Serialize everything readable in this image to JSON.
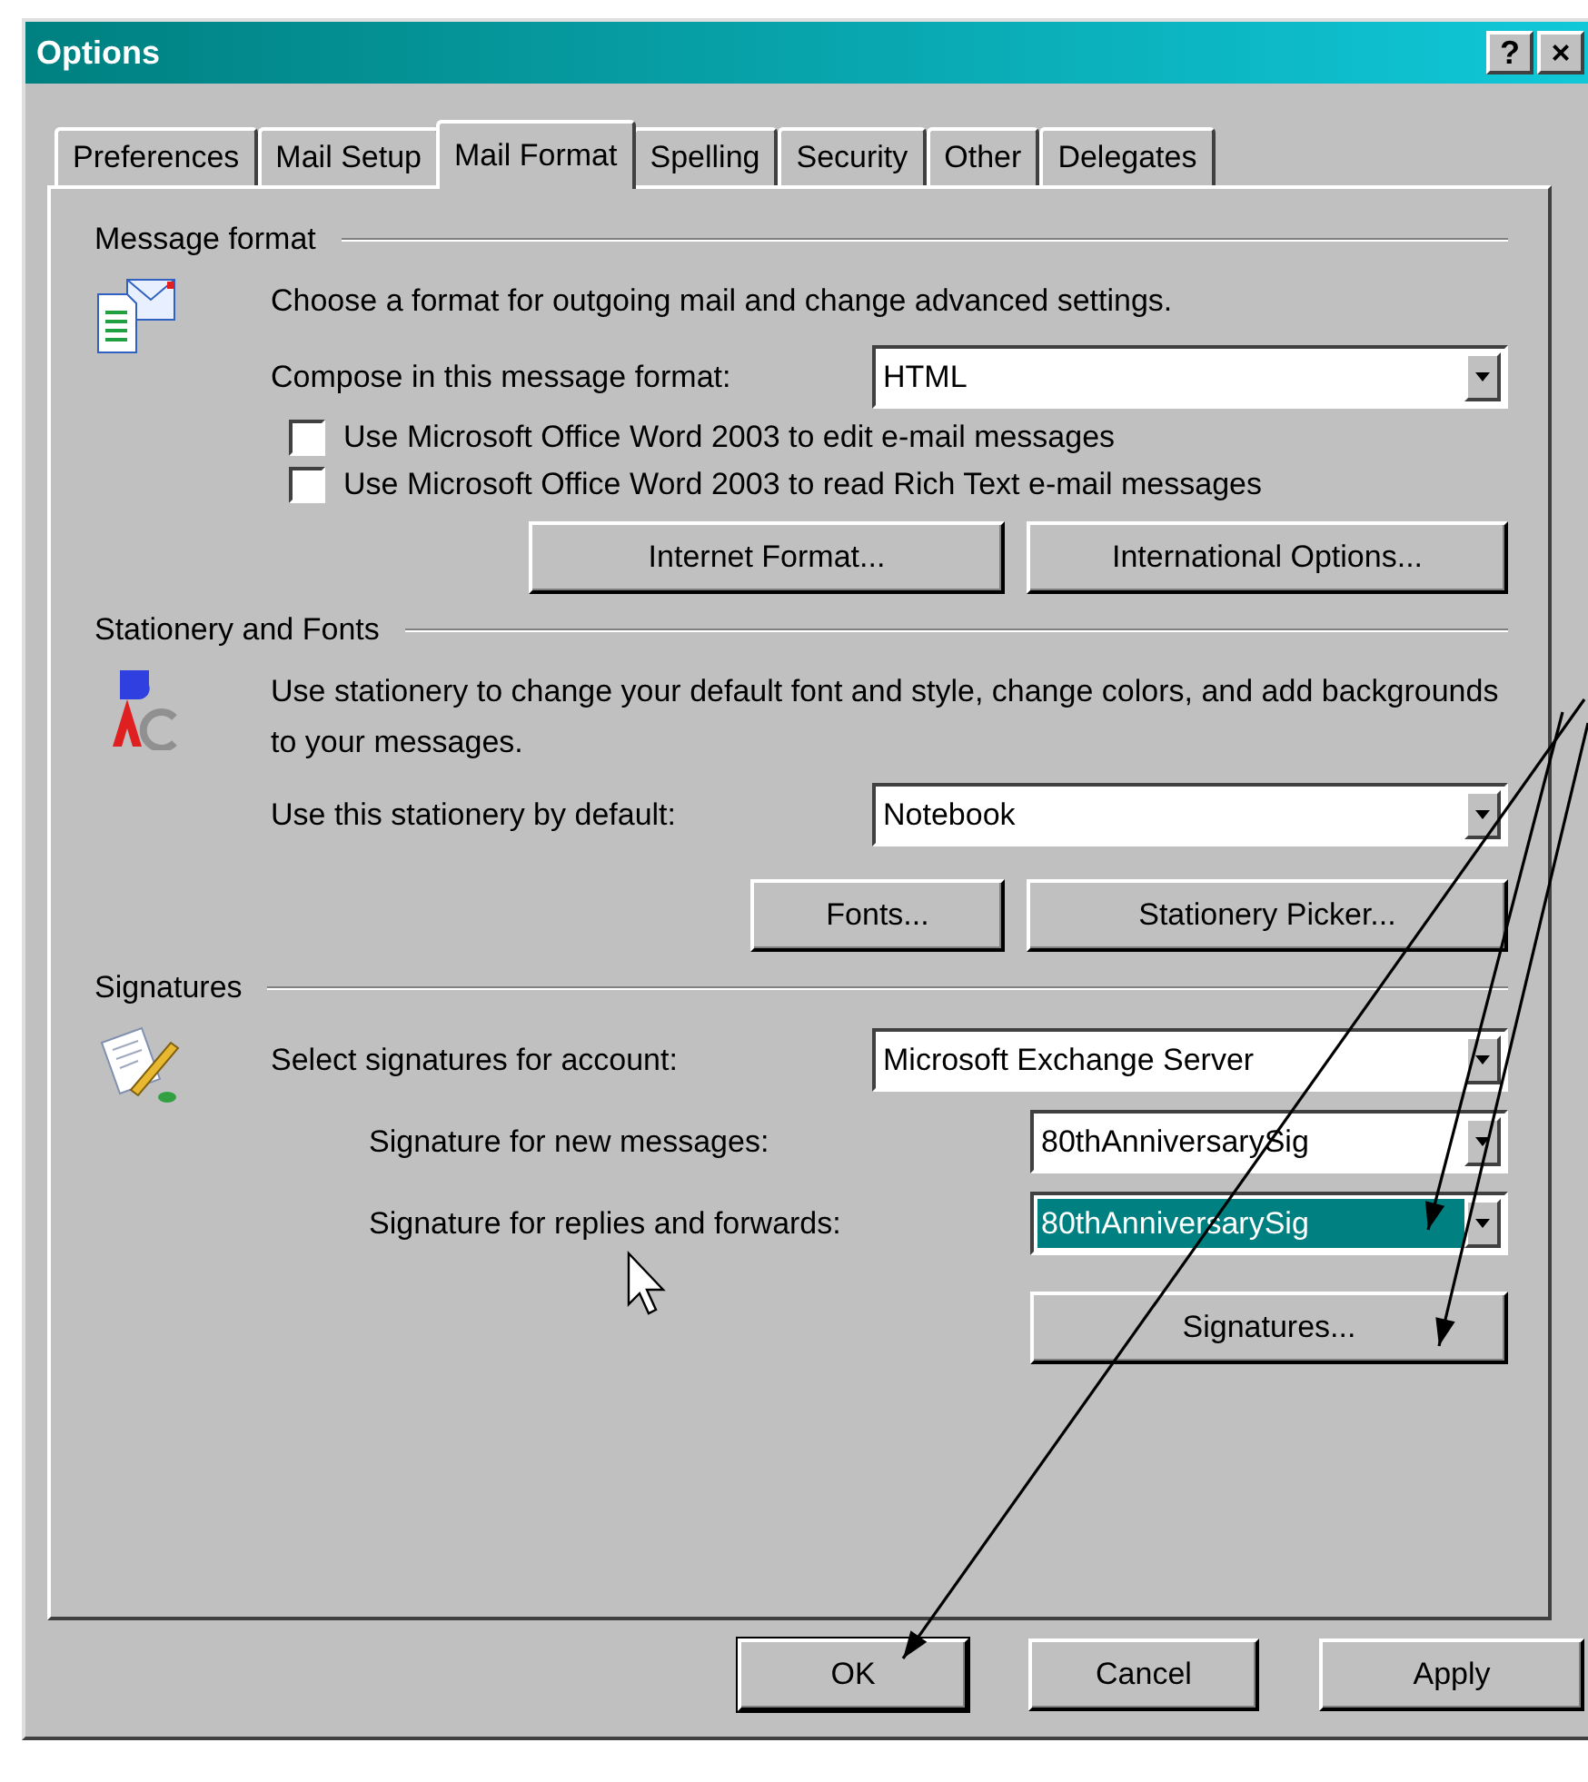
{
  "window": {
    "title": "Options",
    "help_button": "?",
    "close_button": "×"
  },
  "tabs": [
    {
      "label": "Preferences",
      "selected": false
    },
    {
      "label": "Mail Setup",
      "selected": false
    },
    {
      "label": "Mail Format",
      "selected": true
    },
    {
      "label": "Spelling",
      "selected": false
    },
    {
      "label": "Security",
      "selected": false
    },
    {
      "label": "Other",
      "selected": false
    },
    {
      "label": "Delegates",
      "selected": false
    }
  ],
  "message_format": {
    "heading": "Message format",
    "description": "Choose a format for outgoing mail and change advanced settings.",
    "compose_label": "Compose in this message format:",
    "compose_value": "HTML",
    "checkboxes": [
      {
        "label": "Use Microsoft Office Word 2003 to edit e-mail messages",
        "checked": false
      },
      {
        "label": "Use Microsoft Office Word 2003 to read Rich Text e-mail messages",
        "checked": false
      }
    ],
    "buttons": [
      "Internet Format...",
      "International Options..."
    ]
  },
  "stationery": {
    "heading": "Stationery and Fonts",
    "description": "Use stationery to change your default font and style, change colors, and add backgrounds to your messages.",
    "default_label": "Use this stationery by default:",
    "default_value": "Notebook",
    "buttons": [
      "Fonts...",
      "Stationery Picker..."
    ]
  },
  "signatures": {
    "heading": "Signatures",
    "account_label": "Select signatures for account:",
    "account_value": "Microsoft Exchange Server",
    "rows": [
      {
        "label": "Signature for new messages:",
        "value": "80thAnniversarySig",
        "selected": false
      },
      {
        "label": "Signature for replies and forwards:",
        "value": "80thAnniversarySig",
        "selected": true
      }
    ],
    "button": "Signatures..."
  },
  "buttons": [
    "OK",
    "Cancel",
    "Apply"
  ]
}
